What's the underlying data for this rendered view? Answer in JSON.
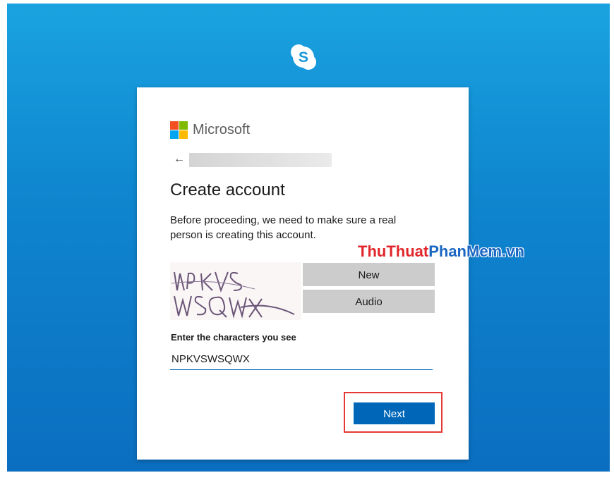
{
  "brand": {
    "microsoft_label": "Microsoft",
    "logo_colors": {
      "red": "#f25022",
      "green": "#7fba00",
      "blue": "#00a4ef",
      "yellow": "#ffb900"
    },
    "skype_color": "#ffffff",
    "accent": "#0067b8"
  },
  "nav": {
    "back_icon": "←"
  },
  "page": {
    "title": "Create account",
    "description": "Before proceeding, we need to make sure a real person is creating this account."
  },
  "captcha": {
    "new_label": "New",
    "audio_label": "Audio"
  },
  "form": {
    "label": "Enter the characters you see",
    "value": "NPKVSWSQWX"
  },
  "actions": {
    "next_label": "Next"
  },
  "watermark": {
    "part1": "ThuThuat",
    "part2": "PhanMem.vn"
  }
}
